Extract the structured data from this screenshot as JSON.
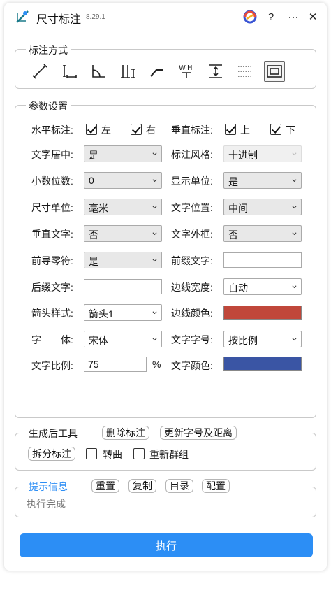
{
  "app": {
    "title": "尺寸标注",
    "version": "8.29.1"
  },
  "titlebar": {
    "help": "?",
    "more": "···",
    "close": "✕"
  },
  "mode_group": {
    "title": "标注方式"
  },
  "params": {
    "title": "参数设置",
    "horizontal_label": "水平标注:",
    "left": "左",
    "right": "右",
    "vertical_label": "垂直标注:",
    "top": "上",
    "bottom": "下",
    "rows": [
      {
        "l_label": "文字居中:",
        "l_value": "是",
        "r_label": "标注风格:",
        "r_value": "十进制"
      },
      {
        "l_label": "小数位数:",
        "l_value": "0",
        "r_label": "显示单位:",
        "r_value": "是"
      },
      {
        "l_label": "尺寸单位:",
        "l_value": "毫米",
        "r_label": "文字位置:",
        "r_value": "中间"
      },
      {
        "l_label": "垂直文字:",
        "l_value": "否",
        "r_label": "文字外框:",
        "r_value": "否"
      },
      {
        "l_label": "前导零符:",
        "l_value": "是",
        "r_label": "前缀文字:",
        "r_value": ""
      },
      {
        "l_label": "后缀文字:",
        "l_value": "",
        "r_label": "边线宽度:",
        "r_value": "自动"
      },
      {
        "l_label": "箭头样式:",
        "l_value": "箭头1",
        "r_label": "边线颜色:"
      },
      {
        "l_label": "字　　体:",
        "l_value": "宋体",
        "r_label": "文字字号:",
        "r_value": "按比例"
      },
      {
        "l_label": "文字比例:",
        "l_value": "75",
        "l_unit": "%",
        "r_label": "文字颜色:"
      }
    ],
    "edge_color": "#c0473a",
    "text_color": "#3a55a4"
  },
  "post_tools": {
    "title": "生成后工具",
    "delete": "删除标注",
    "update": "更新字号及距离",
    "split": "拆分标注",
    "curve": "转曲",
    "regroup": "重新群组"
  },
  "info": {
    "title": "提示信息",
    "title_color": "#2c8ef5",
    "reset": "重置",
    "copy": "复制",
    "catalog": "目录",
    "config": "配置",
    "message": "执行完成"
  },
  "run": "执行"
}
